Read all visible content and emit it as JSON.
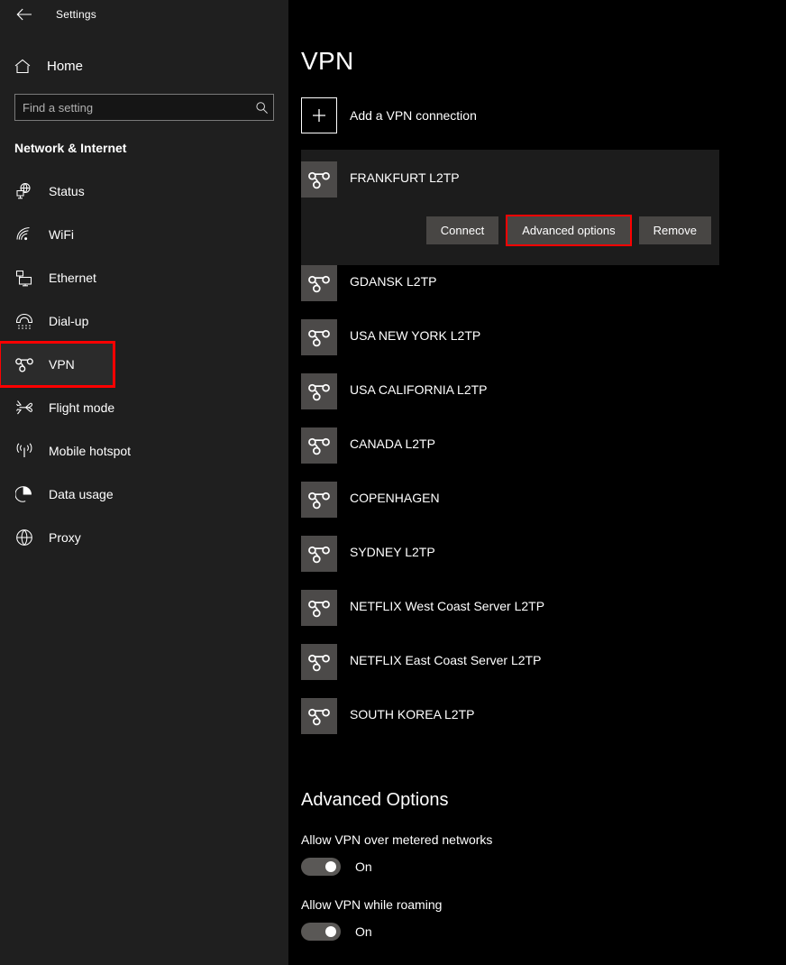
{
  "window": {
    "back_label": "back-arrow",
    "title": "Settings"
  },
  "sidebar": {
    "home_label": "Home",
    "search": {
      "placeholder": "Find a setting",
      "value": "",
      "icon": "search-icon"
    },
    "category": "Network & Internet",
    "items": [
      {
        "label": "Status",
        "icon": "status-icon",
        "selected": false
      },
      {
        "label": "WiFi",
        "icon": "wifi-icon",
        "selected": false
      },
      {
        "label": "Ethernet",
        "icon": "ethernet-icon",
        "selected": false
      },
      {
        "label": "Dial-up",
        "icon": "dialup-icon",
        "selected": false
      },
      {
        "label": "VPN",
        "icon": "vpn-icon",
        "selected": true
      },
      {
        "label": "Flight mode",
        "icon": "airplane-icon",
        "selected": false
      },
      {
        "label": "Mobile hotspot",
        "icon": "hotspot-icon",
        "selected": false
      },
      {
        "label": "Data usage",
        "icon": "pie-chart-icon",
        "selected": false
      },
      {
        "label": "Proxy",
        "icon": "globe-icon",
        "selected": false
      }
    ]
  },
  "main": {
    "page_title": "VPN",
    "add_connection": {
      "label": "Add a VPN connection",
      "icon": "plus-icon"
    },
    "connections": [
      {
        "name": "FRANKFURT L2TP",
        "expanded": true,
        "buttons": [
          {
            "label": "Connect",
            "highlighted": false
          },
          {
            "label": "Advanced options",
            "highlighted": true
          },
          {
            "label": "Remove",
            "highlighted": false
          }
        ]
      },
      {
        "name": "GDANSK L2TP",
        "expanded": false
      },
      {
        "name": "USA NEW YORK L2TP",
        "expanded": false
      },
      {
        "name": "USA CALIFORNIA L2TP",
        "expanded": false
      },
      {
        "name": "CANADA L2TP",
        "expanded": false
      },
      {
        "name": "COPENHAGEN",
        "expanded": false
      },
      {
        "name": "SYDNEY L2TP",
        "expanded": false
      },
      {
        "name": "NETFLIX West Coast Server L2TP",
        "expanded": false
      },
      {
        "name": "NETFLIX East Coast Server L2TP",
        "expanded": false
      },
      {
        "name": "SOUTH KOREA L2TP",
        "expanded": false
      }
    ],
    "advanced": {
      "title": "Advanced Options",
      "options": [
        {
          "label": "Allow VPN over metered networks",
          "state": "On",
          "on": true
        },
        {
          "label": "Allow VPN while roaming",
          "state": "On",
          "on": true
        }
      ]
    }
  },
  "colors": {
    "highlight": "#ff0000",
    "sidebar_bg": "#1f1f1f",
    "main_bg": "#000000",
    "button_bg": "#484644",
    "tile_bg": "#4c4a49"
  }
}
